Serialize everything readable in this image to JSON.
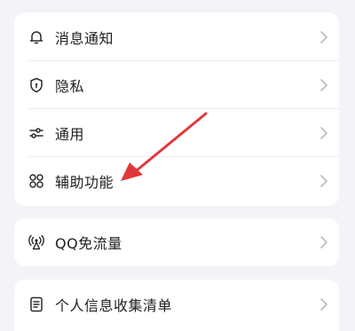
{
  "settings": {
    "groups": [
      {
        "items": [
          {
            "label": "消息通知",
            "icon": "bell-icon"
          },
          {
            "label": "隐私",
            "icon": "shield-icon"
          },
          {
            "label": "通用",
            "icon": "sliders-icon"
          },
          {
            "label": "辅助功能",
            "icon": "grid-icon"
          }
        ]
      },
      {
        "items": [
          {
            "label": "QQ免流量",
            "icon": "signal-tower-icon"
          }
        ]
      },
      {
        "items": [
          {
            "label": "个人信息收集清单",
            "icon": "document-icon"
          }
        ]
      }
    ]
  },
  "colors": {
    "background": "#f4f3f8",
    "card": "#ffffff",
    "text": "#1f1f1f",
    "icon": "#2b2b2b",
    "chevron": "#b9b9bf",
    "annotation_arrow": "#e0383a"
  }
}
